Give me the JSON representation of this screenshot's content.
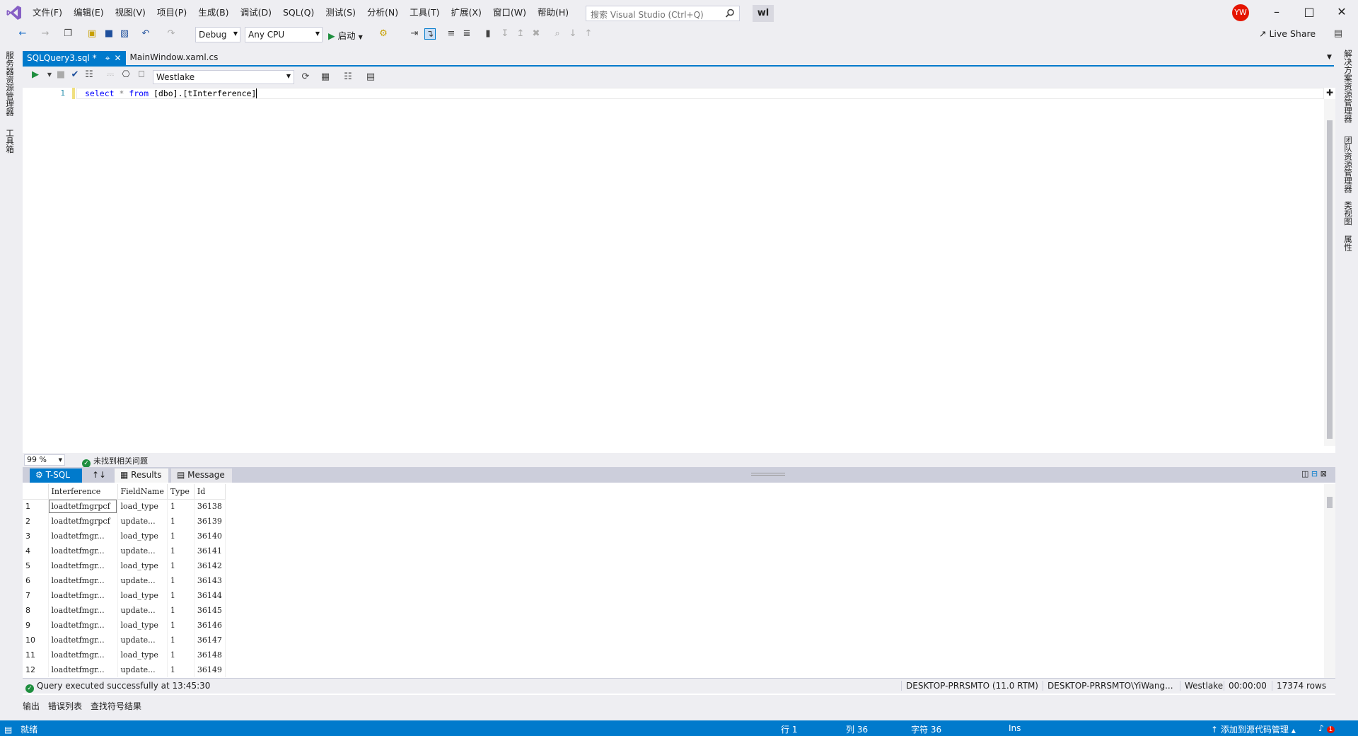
{
  "titlebar": {
    "menu": [
      "文件(F)",
      "编辑(E)",
      "视图(V)",
      "项目(P)",
      "生成(B)",
      "调试(D)",
      "SQL(Q)",
      "测试(S)",
      "分析(N)",
      "工具(T)",
      "扩展(X)",
      "窗口(W)",
      "帮助(H)"
    ],
    "search_placeholder": "搜索 Visual Studio (Ctrl+Q)",
    "badge": "wl",
    "avatar_initials": "YW"
  },
  "toolbar": {
    "config": "Debug",
    "platform": "Any CPU",
    "start_label": "启动",
    "live_share": "Live Share"
  },
  "left_strip": [
    "服务器资源管理器",
    "工具箱"
  ],
  "right_strip": [
    "解决方案资源管理器",
    "团队资源管理器",
    "类视图",
    "属性"
  ],
  "doc_tabs": [
    {
      "label": "SQLQuery3.sql *",
      "active": true
    },
    {
      "label": "MainWindow.xaml.cs",
      "active": false
    }
  ],
  "editor": {
    "database": "Westlake",
    "line_number": "1",
    "code": {
      "k1": "select",
      "star": " * ",
      "k2": "from",
      "rest": " [dbo].[tInterference]"
    },
    "zoom": "99 %",
    "issues": "未找到相关问题"
  },
  "results": {
    "tabs": {
      "tsql": "T-SQL",
      "sort": "↑↓",
      "results": "Results",
      "message": "Message"
    },
    "columns": [
      "Interference",
      "FieldName",
      "Type",
      "Id"
    ],
    "rows": [
      [
        "1",
        "loadtetfmgrpcf",
        "load_type",
        "1",
        "36138"
      ],
      [
        "2",
        "loadtetfmgrpcf",
        "update...",
        "1",
        "36139"
      ],
      [
        "3",
        "loadtetfmgr...",
        "load_type",
        "1",
        "36140"
      ],
      [
        "4",
        "loadtetfmgr...",
        "update...",
        "1",
        "36141"
      ],
      [
        "5",
        "loadtetfmgr...",
        "load_type",
        "1",
        "36142"
      ],
      [
        "6",
        "loadtetfmgr...",
        "update...",
        "1",
        "36143"
      ],
      [
        "7",
        "loadtetfmgr...",
        "load_type",
        "1",
        "36144"
      ],
      [
        "8",
        "loadtetfmgr...",
        "update...",
        "1",
        "36145"
      ],
      [
        "9",
        "loadtetfmgr...",
        "load_type",
        "1",
        "36146"
      ],
      [
        "10",
        "loadtetfmgr...",
        "update...",
        "1",
        "36147"
      ],
      [
        "11",
        "loadtetfmgr...",
        "load_type",
        "1",
        "36148"
      ],
      [
        "12",
        "loadtetfmgr...",
        "update...",
        "1",
        "36149"
      ]
    ]
  },
  "query_status": {
    "message": "Query executed successfully at 13:45:30",
    "server": "DESKTOP-PRRSMTO (11.0 RTM)",
    "user": "DESKTOP-PRRSMTO\\YiWang...",
    "database": "Westlake",
    "elapsed": "00:00:00",
    "rows": "17374 rows"
  },
  "bottom_tabs": [
    "输出",
    "错误列表",
    "查找符号结果"
  ],
  "statusbar": {
    "ready": "就绪",
    "line": "行 1",
    "col": "列 36",
    "char": "字符 36",
    "ins": "Ins",
    "source_control": "添加到源代码管理",
    "notifications": "1"
  }
}
